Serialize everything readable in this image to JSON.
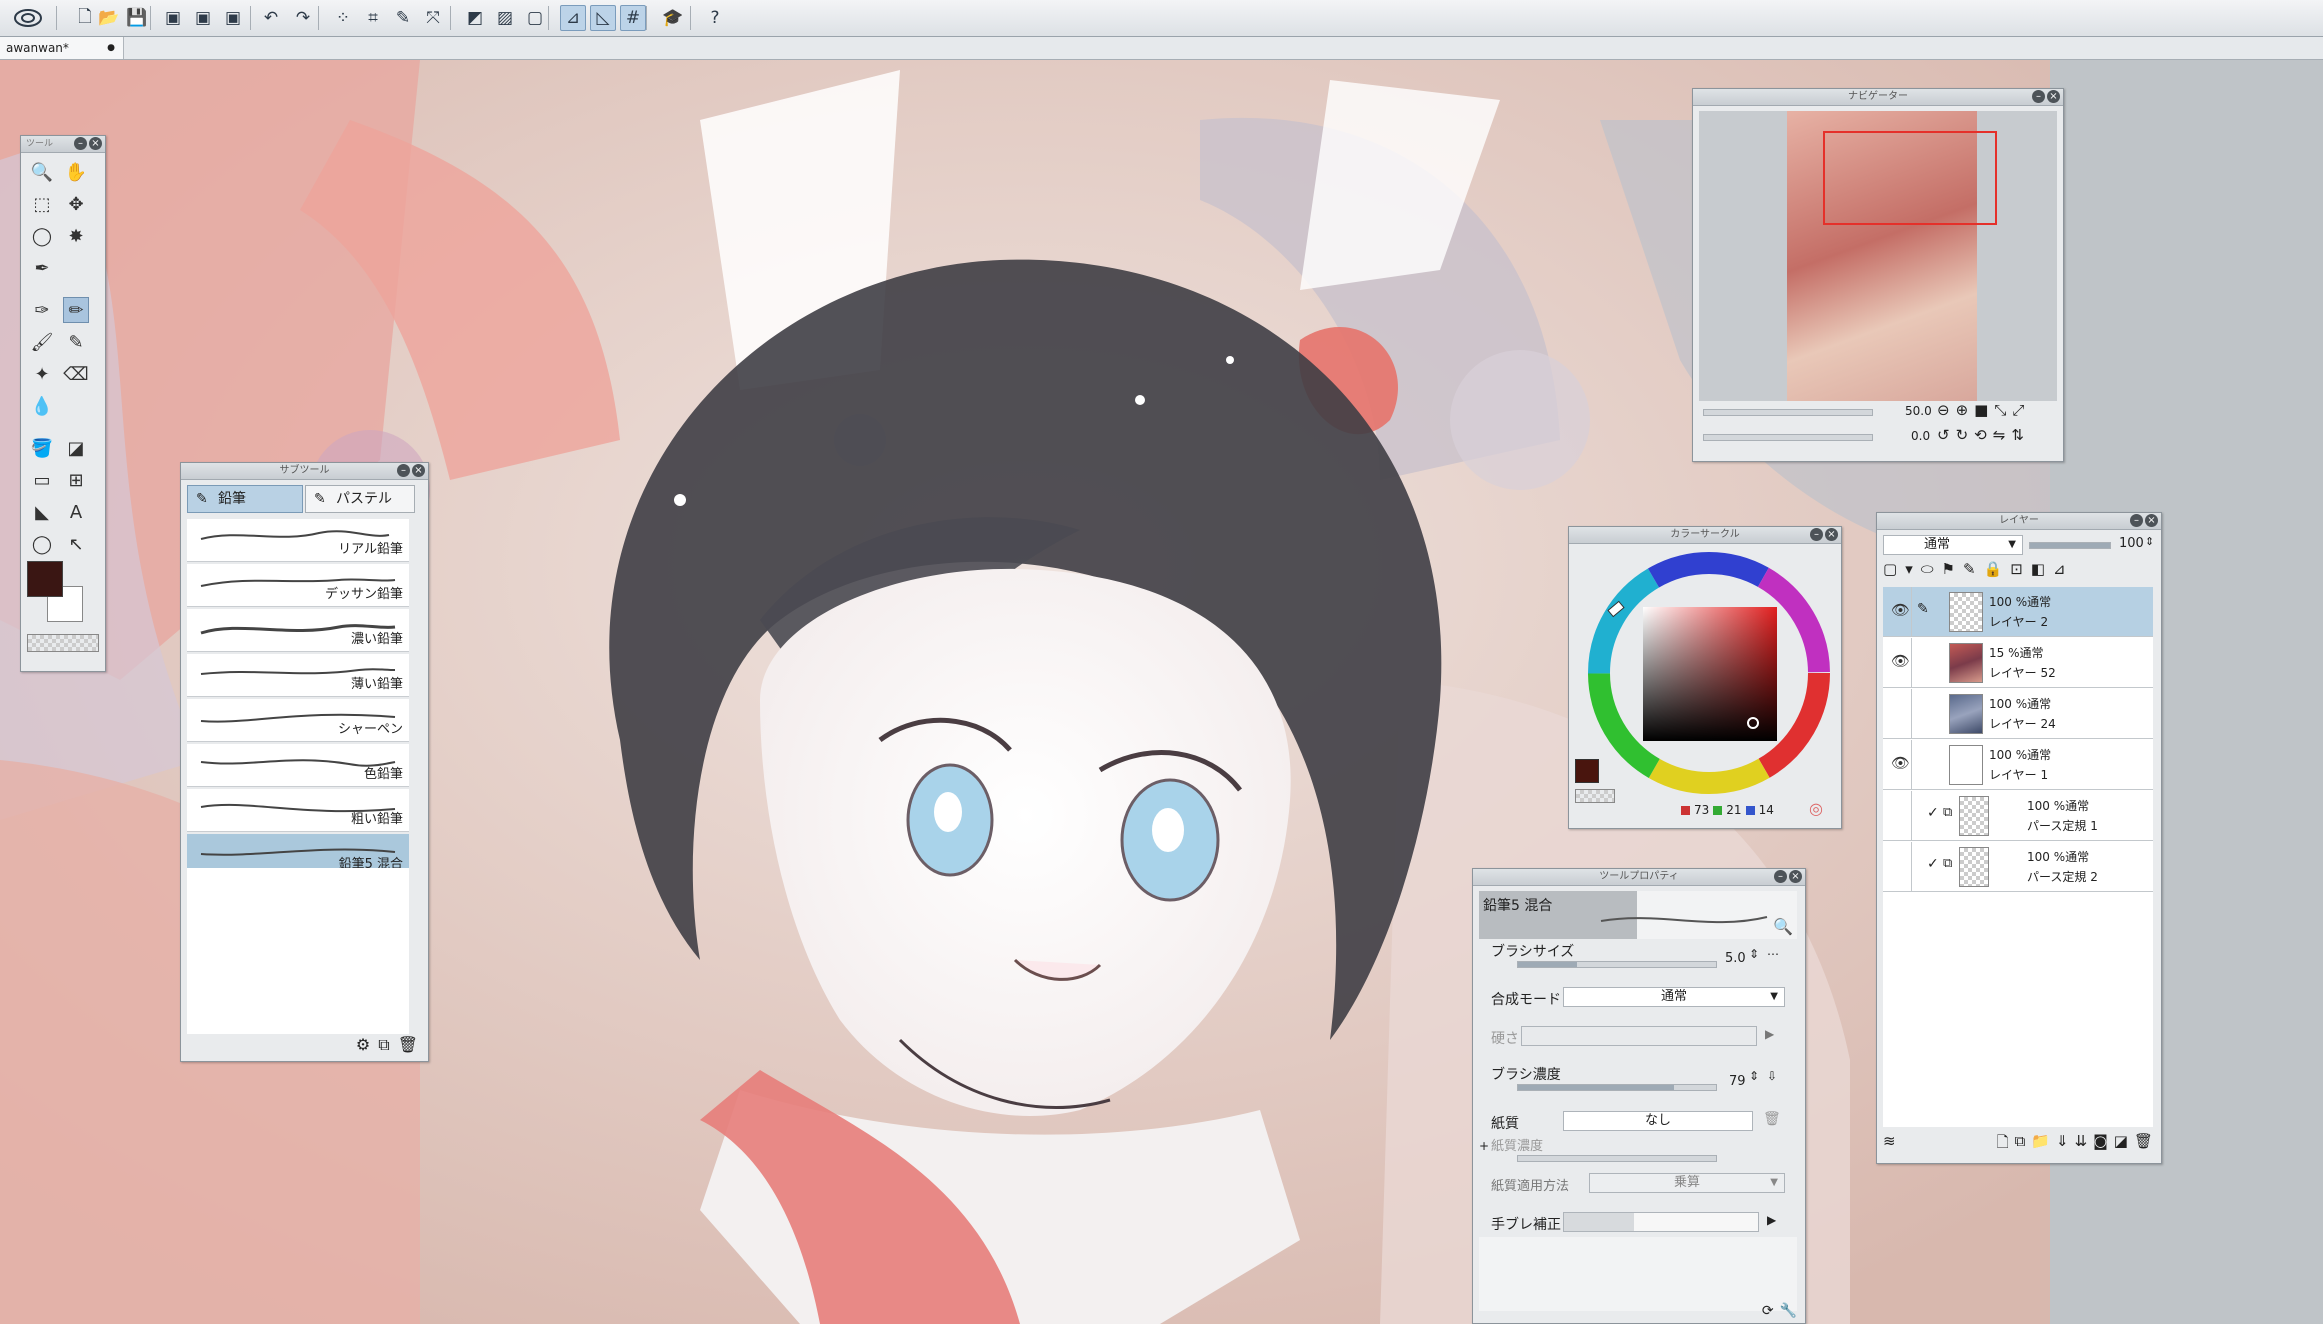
{
  "app": {
    "icon": "app-logo-icon",
    "document_tab": "awanwan*",
    "tab_close": "●"
  },
  "toolbar": [
    {
      "name": "new-icon",
      "glyph": "🗋"
    },
    {
      "name": "open-icon",
      "glyph": "📂"
    },
    {
      "name": "save-icon",
      "glyph": "💾"
    },
    {
      "name": "export-jpg-icon",
      "glyph": "▣"
    },
    {
      "name": "export-png-icon",
      "glyph": "▣"
    },
    {
      "name": "export-psd-icon",
      "glyph": "▣"
    },
    {
      "name": "undo-icon",
      "glyph": "↶"
    },
    {
      "name": "redo-icon",
      "glyph": "↷"
    },
    {
      "name": "clear-selection-icon",
      "glyph": "⁘"
    },
    {
      "name": "crop-icon",
      "glyph": "⌗"
    },
    {
      "name": "transform-icon",
      "glyph": "✎"
    },
    {
      "name": "fit-icon",
      "glyph": "⤧"
    },
    {
      "name": "fill-icon",
      "glyph": "◩"
    },
    {
      "name": "gradient-icon",
      "glyph": "▨"
    },
    {
      "name": "frame-icon",
      "glyph": "▢"
    },
    {
      "name": "snap-ruler-icon",
      "glyph": "⊿"
    },
    {
      "name": "snap-special-ruler-icon",
      "glyph": "◺"
    },
    {
      "name": "snap-grid-icon",
      "glyph": "#"
    },
    {
      "name": "learn-icon",
      "glyph": "🎓"
    },
    {
      "name": "help-icon",
      "glyph": "?"
    }
  ],
  "tool_palette": {
    "title": "ツール",
    "tools": [
      {
        "name": "zoom-tool-icon",
        "glyph": "🔍"
      },
      {
        "name": "hand-tool-icon",
        "glyph": "✋"
      },
      {
        "name": "object-tool-icon",
        "glyph": "⬚"
      },
      {
        "name": "move-layer-tool-icon",
        "glyph": "✥"
      },
      {
        "name": "lasso-tool-icon",
        "glyph": "◯"
      },
      {
        "name": "auto-select-tool-icon",
        "glyph": "✸"
      },
      {
        "name": "eyedropper-tool-icon",
        "glyph": "✒"
      },
      {
        "name": "empty-slot",
        "glyph": ""
      },
      {
        "name": "pen-tool-icon",
        "glyph": "✑"
      },
      {
        "name": "pencil-tool-icon",
        "glyph": "✏"
      },
      {
        "name": "brush-tool-icon",
        "glyph": "🖌"
      },
      {
        "name": "airbrush-tool-icon",
        "glyph": "✎"
      },
      {
        "name": "decoration-tool-icon",
        "glyph": "✦"
      },
      {
        "name": "eraser-tool-icon",
        "glyph": "⌫"
      },
      {
        "name": "blend-tool-icon",
        "glyph": "💧"
      },
      {
        "name": "empty-slot-2",
        "glyph": ""
      },
      {
        "name": "fill-tool-icon",
        "glyph": "🪣"
      },
      {
        "name": "gradient-tool-icon",
        "glyph": "◪"
      },
      {
        "name": "figure-tool-icon",
        "glyph": "▭"
      },
      {
        "name": "frame-border-tool-icon",
        "glyph": "⊞"
      },
      {
        "name": "ruler-tool-icon",
        "glyph": "◣"
      },
      {
        "name": "text-tool-icon",
        "glyph": "A"
      },
      {
        "name": "balloon-tool-icon",
        "glyph": "◯"
      },
      {
        "name": "correct-line-tool-icon",
        "glyph": "↖"
      }
    ],
    "main_color": "#3a1613",
    "sub_color": "#ffffff"
  },
  "sub_tool": {
    "title": "サブツール",
    "tabs": [
      "鉛筆",
      "パステル"
    ],
    "brushes": [
      "リアル鉛筆",
      "デッサン鉛筆",
      "濃い鉛筆",
      "薄い鉛筆",
      "シャーペン",
      "色鉛筆",
      "粗い鉛筆",
      "鉛筆5 混合"
    ],
    "selected": 7
  },
  "navigator": {
    "title": "ナビゲーター",
    "zoom": "50.0",
    "rotation": "0.0"
  },
  "color_circle": {
    "title": "カラーサークル",
    "r": "73",
    "g": "21",
    "b": "14",
    "current": "#49150e"
  },
  "tool_property": {
    "title": "ツールプロパティ",
    "brush_name": "鉛筆5 混合",
    "brush_size_label": "ブラシサイズ",
    "brush_size": "5.0",
    "brush_size_pct": 0.3,
    "blend_mode_label": "合成モード",
    "blend_mode": "通常",
    "hardness_label": "硬さ",
    "density_label": "ブラシ濃度",
    "density": "79",
    "density_pct": 0.79,
    "paper_label": "紙質",
    "paper": "なし",
    "paper_density_label": "紙質濃度",
    "paper_method_label": "紙質適用方法",
    "paper_method": "乗算",
    "stabilizer_label": "手ブレ補正"
  },
  "layer": {
    "title": "レイヤー",
    "blend": "通常",
    "opacity": "100",
    "layers": [
      {
        "opacity": "100 %通常",
        "name": "レイヤー 2",
        "visible": true,
        "selected": true,
        "thumb": "checker"
      },
      {
        "opacity": "15 %通常",
        "name": "レイヤー 52",
        "visible": true,
        "selected": false,
        "thumb": "art"
      },
      {
        "opacity": "100 %通常",
        "name": "レイヤー 24",
        "visible": false,
        "selected": false,
        "thumb": "art2"
      },
      {
        "opacity": "100 %通常",
        "name": "レイヤー 1",
        "visible": true,
        "selected": false,
        "thumb": "white"
      },
      {
        "opacity": "100 %通常",
        "name": "パース定規 1",
        "visible": false,
        "selected": false,
        "thumb": "checker"
      },
      {
        "opacity": "100 %通常",
        "name": "パース定規 2",
        "visible": false,
        "selected": false,
        "thumb": "checker"
      }
    ]
  }
}
